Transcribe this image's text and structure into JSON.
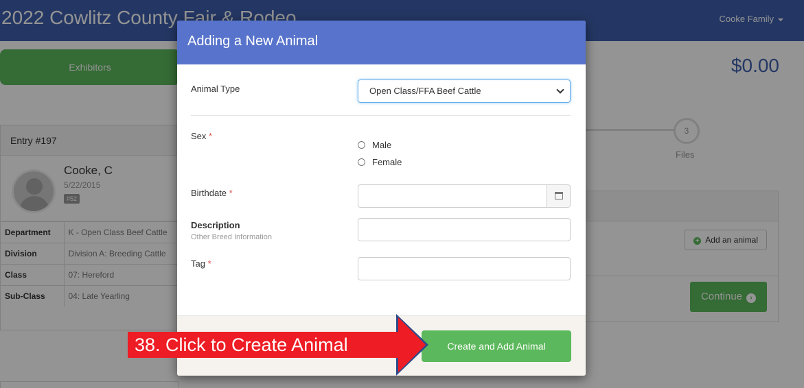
{
  "app": {
    "title": "2022 Cowlitz County Fair & Rodeo",
    "user_menu": "Cooke Family"
  },
  "background": {
    "exhibitors_label": "Exhibitors",
    "amount": "$0.00",
    "step_number": "3",
    "step_label": "Files",
    "entry_title": "Entry #197",
    "person": {
      "name": "Cooke, C",
      "date": "5/22/2015",
      "badge": "#52"
    },
    "info_rows": [
      {
        "key": "Department",
        "value": "K - Open Class Beef Cattle"
      },
      {
        "key": "Division",
        "value": "Division A: Breeding Cattle"
      },
      {
        "key": "Class",
        "value": "07: Hereford"
      },
      {
        "key": "Sub-Class",
        "value": "04: Late Yearling"
      }
    ],
    "add_animal_label": "Add an animal",
    "continue_label": "Continue"
  },
  "modal": {
    "title": "Adding a New Animal",
    "animal_type_label": "Animal Type",
    "animal_type_value": "Open Class/FFA Beef Cattle",
    "sex_label": "Sex",
    "sex_options": [
      "Male",
      "Female"
    ],
    "birthdate_label": "Birthdate",
    "description_label": "Description",
    "description_sub": "Other Breed Information",
    "tag_label": "Tag",
    "required_mark": "*",
    "create_button": "Create and Add Animal"
  },
  "annotation": {
    "callout_text": "38. Click to Create Animal",
    "color": "#ee1c24"
  }
}
